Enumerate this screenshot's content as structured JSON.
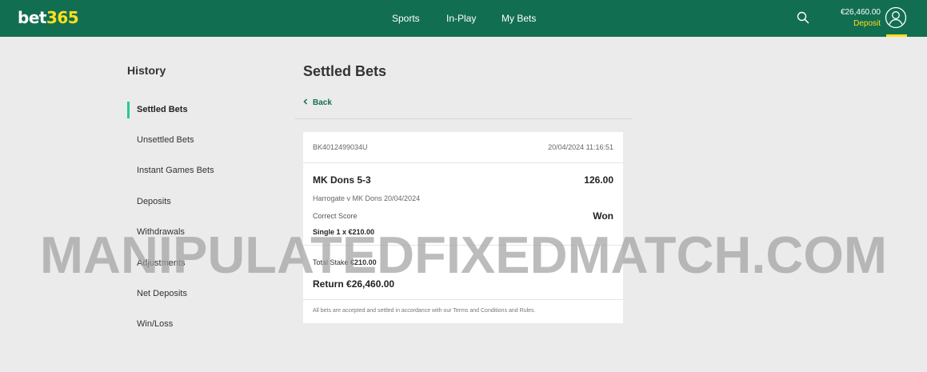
{
  "header": {
    "logo_part1": "bet",
    "logo_part2": "365",
    "nav": [
      "Sports",
      "In-Play",
      "My Bets"
    ],
    "balance": "€26,460.00",
    "deposit_label": "Deposit",
    "icons": [
      "search-icon",
      "user-account-icon"
    ],
    "colors": {
      "header_bg": "#126e51",
      "brand_yellow": "#ffdf1b",
      "active_accent": "#26c99a"
    }
  },
  "sidebar": {
    "title": "History",
    "items": [
      {
        "label": "Settled Bets",
        "active": true
      },
      {
        "label": "Unsettled Bets",
        "active": false
      },
      {
        "label": "Instant Games Bets",
        "active": false
      },
      {
        "label": "Deposits",
        "active": false
      },
      {
        "label": "Withdrawals",
        "active": false
      },
      {
        "label": "Adjustments",
        "active": false
      },
      {
        "label": "Net Deposits",
        "active": false
      },
      {
        "label": "Win/Loss",
        "active": false
      }
    ]
  },
  "main": {
    "title": "Settled Bets",
    "back_label": "Back",
    "bet": {
      "reference": "BK4012499034U",
      "datetime": "20/04/2024 11:16:51",
      "selection": "MK Dons 5-3",
      "odds": "126.00",
      "event": "Harrogate v MK Dons 20/04/2024",
      "market": "Correct Score",
      "result": "Won",
      "bet_type": "Single 1 x €210.00",
      "stake_label": "Total Stake",
      "stake_value": "€210.00",
      "return_label": "Return",
      "return_value": "€26,460.00",
      "terms": "All bets are accepted and settled in accordance with our Terms and Conditions and Rules."
    }
  },
  "watermark": "MANIPULATEDFIXEDMATCH.COM"
}
